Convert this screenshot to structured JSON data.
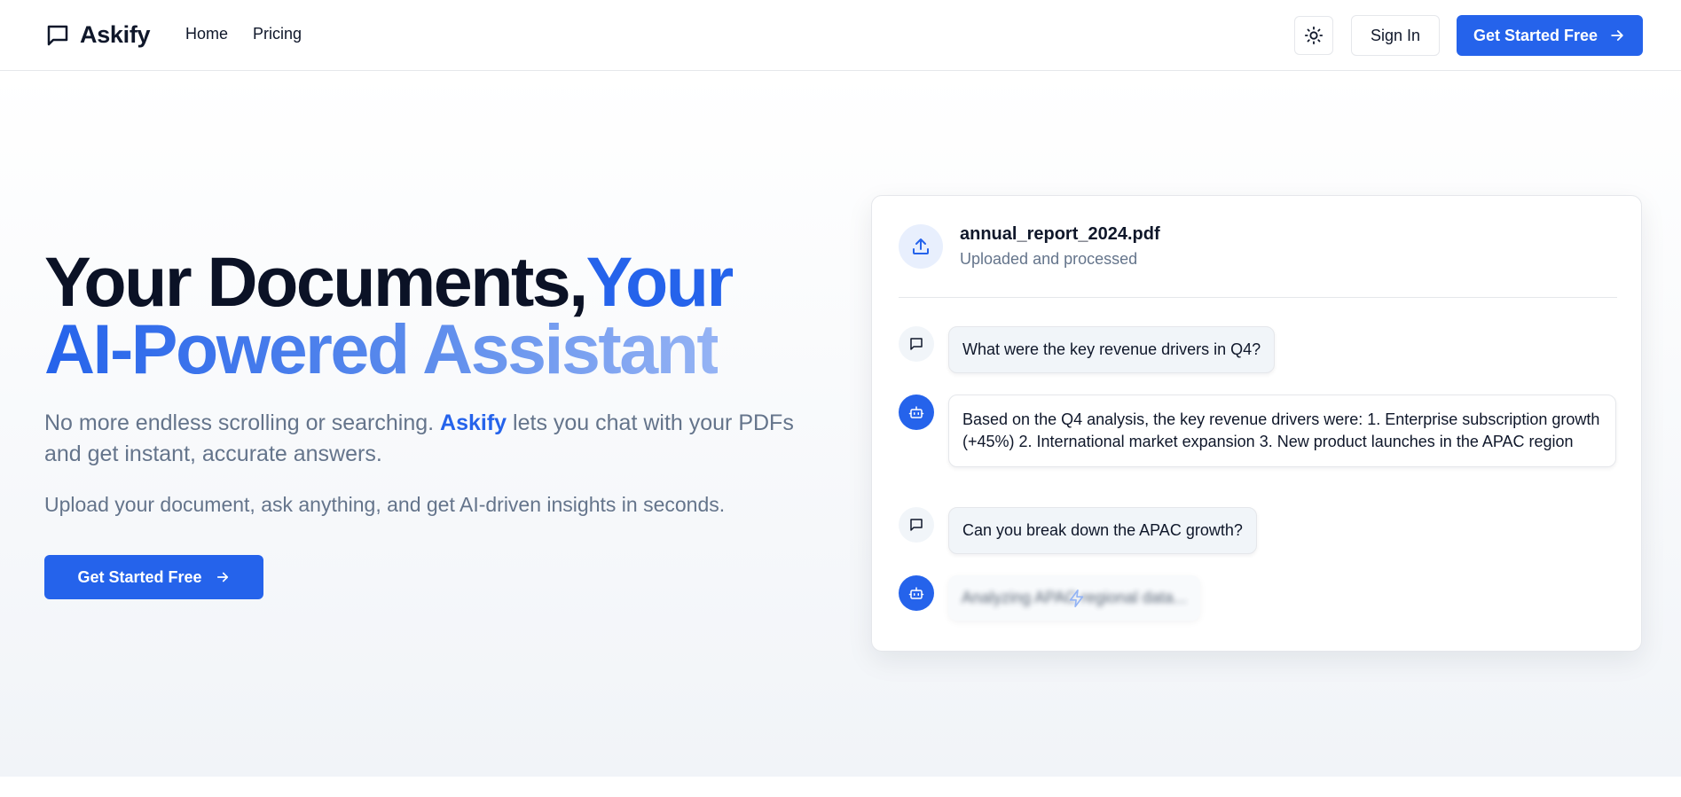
{
  "header": {
    "logo_text": "Askify",
    "nav": [
      "Home",
      "Pricing"
    ],
    "theme_icon": "sun-icon",
    "signin_label": "Sign In",
    "cta_label": "Get Started Free"
  },
  "hero": {
    "headline_part1": "Your Documents,",
    "headline_part2": "Your",
    "headline_line2": "AI-Powered Assistant",
    "sub1_before": "No more endless scrolling or searching.",
    "sub1_brand": "Askify",
    "sub1_after": "lets you chat with your PDFs and get instant, accurate answers.",
    "sub2": "Upload your document, ask anything, and get AI-driven insights in seconds.",
    "cta_label": "Get Started Free"
  },
  "chat": {
    "file_name": "annual_report_2024.pdf",
    "file_status": "Uploaded and processed",
    "messages": [
      {
        "role": "user",
        "text": "What were the key revenue drivers in Q4?"
      },
      {
        "role": "bot",
        "text": "Based on the Q4 analysis, the key revenue drivers were: 1. Enterprise subscription growth (+45%) 2. International market expansion 3. New product launches in the APAC region"
      },
      {
        "role": "user",
        "text": "Can you break down the APAC growth?"
      },
      {
        "role": "bot",
        "text": "Analyzing APAC regional data..."
      }
    ]
  },
  "colors": {
    "accent": "#2563eb",
    "text": "#0f172a",
    "muted": "#64748b"
  }
}
